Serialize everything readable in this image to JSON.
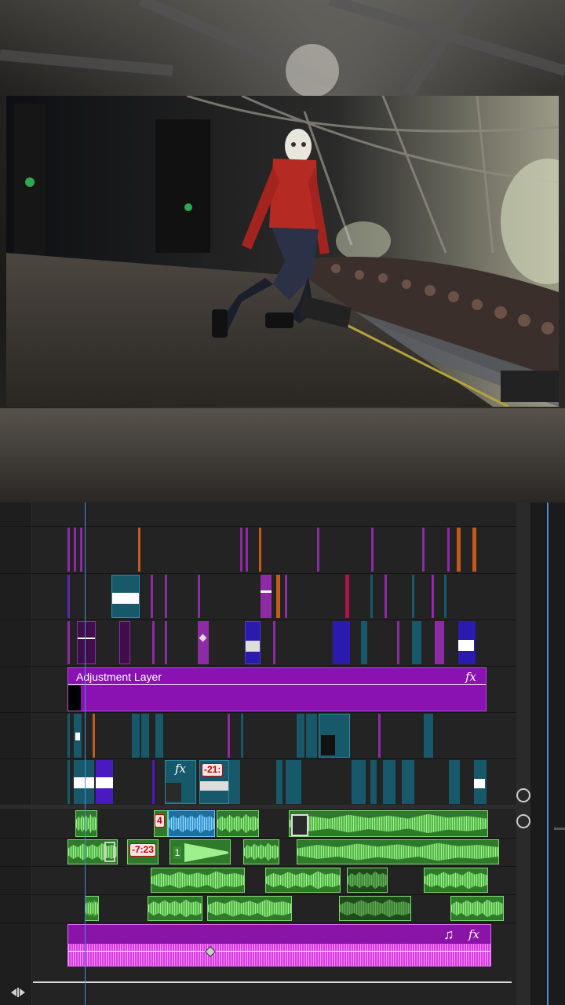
{
  "preview": {
    "description_hidden": false
  },
  "timeline": {
    "adjustment_layer": {
      "label": "Adjustment Layer",
      "fx": "fx"
    },
    "badges": {
      "badge_a": "-21:",
      "badge_b": "-7:23",
      "badge_c": "4",
      "clip_number": "1"
    },
    "music_clip": {
      "note": "♫",
      "fx": "fx"
    },
    "fx_small": "fx",
    "playhead_position": "x=108"
  },
  "colors": {
    "timeline_bg": "#232323",
    "playhead": "#4a8bd8",
    "adjustment": "#8a12b3",
    "teal": "#17596b",
    "audio": "#2f7a2a",
    "audio_wave": "#9ef08f",
    "music": "#c43fd0"
  },
  "icons": {
    "zoom_fit": "zoom-fit-icon",
    "scroll_handle": "scroll-handle-icon"
  }
}
